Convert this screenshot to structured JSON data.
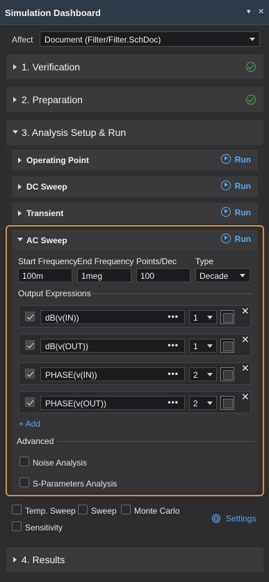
{
  "window": {
    "title": "Simulation Dashboard",
    "pin_glyph": "▾",
    "close_glyph": "✕"
  },
  "affect": {
    "label": "Affect",
    "value": "Document (Filter/Filter.SchDoc)"
  },
  "sections": {
    "verification": {
      "label": "1. Verification",
      "status_icon": "check-circle-icon"
    },
    "preparation": {
      "label": "2. Preparation",
      "status_icon": "check-circle-icon"
    },
    "analysis": {
      "label": "3. Analysis Setup & Run"
    },
    "results": {
      "label": "4. Results"
    }
  },
  "analyses": {
    "operating_point": {
      "label": "Operating Point",
      "run": "Run"
    },
    "dc_sweep": {
      "label": "DC Sweep",
      "run": "Run"
    },
    "transient": {
      "label": "Transient",
      "run": "Run"
    },
    "ac_sweep": {
      "label": "AC Sweep",
      "run": "Run",
      "fields": {
        "start_frequency": {
          "label": "Start Frequency",
          "value": "100m"
        },
        "end_frequency": {
          "label": "End Frequency",
          "value": "1meg"
        },
        "points_dec": {
          "label": "Points/Dec",
          "value": "100"
        },
        "type": {
          "label": "Type",
          "value": "Decade"
        }
      },
      "output_expressions_label": "Output Expressions",
      "expressions": [
        {
          "expr": "dB(v(IN))",
          "plot": "1",
          "checked": true
        },
        {
          "expr": "dB(v(OUT))",
          "plot": "1",
          "checked": true
        },
        {
          "expr": "PHASE(v(IN))",
          "plot": "2",
          "checked": true
        },
        {
          "expr": "PHASE(v(OUT))",
          "plot": "2",
          "checked": true
        }
      ],
      "dots": "•••",
      "add_label": "+ Add",
      "advanced_label": "Advanced",
      "advanced_options": [
        "Noise Analysis",
        "S-Parameters Analysis"
      ]
    }
  },
  "extra_options": {
    "temp_sweep": "Temp. Sweep",
    "sweep": "Sweep",
    "monte_carlo": "Monte Carlo",
    "sensitivity": "Sensitivity",
    "settings": "Settings"
  },
  "colors": {
    "accent_run": "#5aaaf0",
    "status_ok": "#53a84e",
    "highlight": "#e8893a"
  }
}
